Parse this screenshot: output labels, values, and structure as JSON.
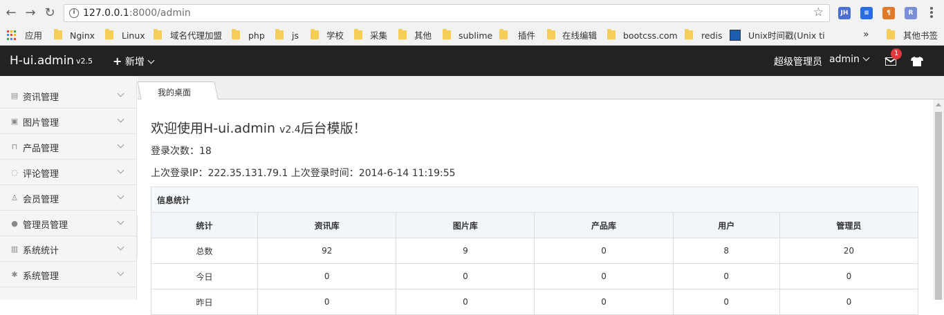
{
  "browser": {
    "url_host": "127.0.0.1",
    "url_path": ":8000/admin",
    "extensions": [
      {
        "name": "jh-extension-icon",
        "label": "JH",
        "color": "#4a6fd0"
      },
      {
        "name": "save-extension-icon",
        "label": "≡",
        "color": "#2a6de0"
      },
      {
        "name": "pilcrow-extension-icon",
        "label": "¶",
        "color": "#e0792a"
      },
      {
        "name": "r-extension-icon",
        "label": "R",
        "color": "#7b8fd8"
      }
    ]
  },
  "bookmarks": {
    "apps": "应用",
    "items": [
      "Nginx",
      "Linux",
      "域名代理加盟",
      "php",
      "js",
      "学校",
      "采集",
      "其他",
      "sublime",
      "插件",
      "在线编辑",
      "bootcss.com",
      "redis",
      "Unix时间戳(Unix tin"
    ],
    "overflow": "»",
    "other": "其他书签"
  },
  "header": {
    "logo": "H-ui.admin",
    "version": "v2.5",
    "new_button": "新增",
    "user_role": "超级管理员",
    "user_name": "admin",
    "message_count": "1",
    "colors": {
      "background": "#222222",
      "badge": "#e0383c"
    }
  },
  "sidebar": {
    "items": [
      {
        "label": "资讯管理",
        "icon": "news-icon"
      },
      {
        "label": "图片管理",
        "icon": "image-icon"
      },
      {
        "label": "产品管理",
        "icon": "bag-icon"
      },
      {
        "label": "评论管理",
        "icon": "comment-icon"
      },
      {
        "label": "会员管理",
        "icon": "member-icon"
      },
      {
        "label": "管理员管理",
        "icon": "admin-user-icon"
      },
      {
        "label": "系统统计",
        "icon": "stats-icon"
      },
      {
        "label": "系统管理",
        "icon": "settings-gear-icon"
      }
    ]
  },
  "tabs": {
    "active": "我的桌面"
  },
  "main": {
    "welcome_prefix": "欢迎使用H-ui.admin ",
    "welcome_version": "v2.4",
    "welcome_suffix": "后台模版！",
    "login_count": "登录次数：18",
    "last_login": "上次登录IP：222.35.131.79.1  上次登录时间：2014-6-14 11:19:55",
    "table": {
      "caption": "信息统计",
      "headers": [
        "统计",
        "资讯库",
        "图片库",
        "产品库",
        "用户",
        "管理员"
      ],
      "rows": [
        [
          "总数",
          "92",
          "9",
          "0",
          "8",
          "20"
        ],
        [
          "今日",
          "0",
          "0",
          "0",
          "0",
          "0"
        ],
        [
          "昨日",
          "0",
          "0",
          "0",
          "0",
          "0"
        ]
      ]
    }
  }
}
